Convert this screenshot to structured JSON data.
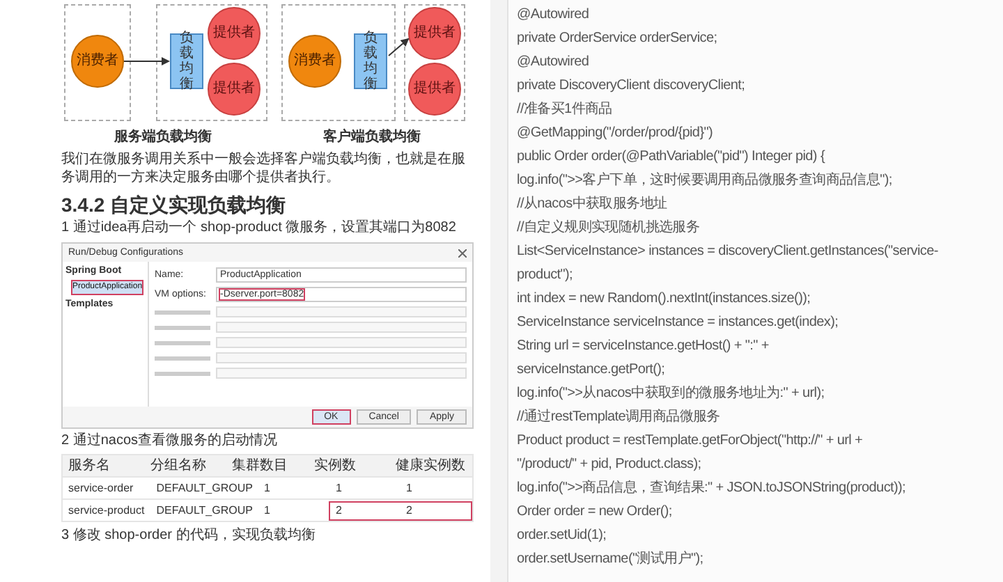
{
  "diagram": [
    {
      "kind": "server",
      "caption": "服务端负载均衡",
      "consumer": "消费者",
      "balancer": "负载均衡",
      "providers": [
        "提供者",
        "提供者"
      ]
    },
    {
      "kind": "client",
      "caption": "客户端负载均衡",
      "consumer": "消费者",
      "balancer": "负载均衡",
      "providers": [
        "提供者",
        "提供者"
      ]
    }
  ],
  "intro": "我们在微服务调用关系中一般会选择客户端负载均衡，也就是在服务调用的一方来决定服务由哪个提供者执行。",
  "heading": "3.4.2 自定义实现负载均衡",
  "step_1": "1 通过idea再启动一个 shop-product 微服务，设置其端口为8082",
  "dialog": {
    "title": "Run/Debug Configurations",
    "tree": [
      {
        "label": "Spring Boot",
        "children": [
          {
            "label": "ProductApplication",
            "selected": true
          }
        ]
      },
      {
        "label": "Templates"
      }
    ],
    "name_label": "Name:",
    "name_value": "ProductApplication",
    "vm_label": "VM options:",
    "vm_value": "-Dserver.port=8082",
    "buttons": [
      {
        "label": "OK",
        "selected": true
      },
      {
        "label": "Cancel",
        "selected": false
      },
      {
        "label": "Apply",
        "selected": false
      }
    ]
  },
  "step_2": "2 通过nacos查看微服务的启动情况",
  "table": {
    "columns": [
      "服务名",
      "分组名称",
      "集群数目",
      "实例数",
      "健康实例数"
    ],
    "rows": [
      {
        "cells": [
          "service-order",
          "DEFAULT_GROUP",
          "1",
          "1",
          "1"
        ],
        "highlighted": false
      },
      {
        "cells": [
          "service-product",
          "DEFAULT_GROUP",
          "1",
          "2",
          "2"
        ],
        "highlighted": true
      }
    ]
  },
  "step_3": "3 修改 shop-order 的代码，实现负载均衡",
  "code_lines": [
    "@Autowired",
    "private OrderService orderService;",
    "@Autowired",
    "private DiscoveryClient discoveryClient;",
    "//准备买1件商品",
    "@GetMapping(\"/order/prod/{pid}\")",
    "public Order order(@PathVariable(\"pid\") Integer pid) {",
    "log.info(\">>客户下单，这时候要调用商品微服务查询商品信息\");",
    "//从nacos中获取服务地址",
    "//自定义规则实现随机挑选服务",
    "List<ServiceInstance> instances = discoveryClient.getInstances(\"service-",
    "product\");",
    "int index = new Random().nextInt(instances.size());",
    "ServiceInstance serviceInstance = instances.get(index);",
    "String url = serviceInstance.getHost() + \":\" +",
    "serviceInstance.getPort();",
    "log.info(\">>从nacos中获取到的微服务地址为:\" + url);",
    "//通过restTemplate调用商品微服务",
    "Product product = restTemplate.getForObject(\"http://\" + url +",
    "\"/product/\" + pid, Product.class);",
    "log.info(\">>商品信息，查询结果:\" + JSON.toJSONString(product));",
    "Order order = new Order();",
    "order.setUid(1);",
    "order.setUsername(\"测试用户\");"
  ]
}
